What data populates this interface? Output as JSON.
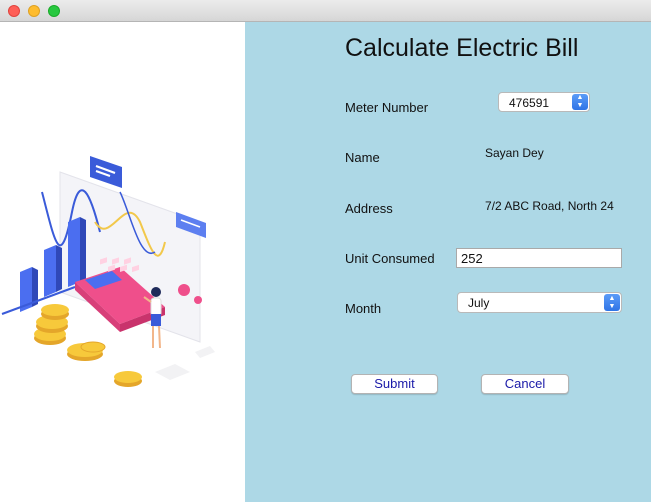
{
  "window": {
    "controls": [
      "close",
      "minimize",
      "maximize"
    ]
  },
  "form": {
    "title": "Calculate Electric Bill",
    "meter_number": {
      "label": "Meter Number",
      "value": "476591"
    },
    "name": {
      "label": "Name",
      "value": "Sayan Dey"
    },
    "address": {
      "label": "Address",
      "value": "7/2 ABC Road, North 24"
    },
    "unit_consumed": {
      "label": "Unit Consumed",
      "value": "252"
    },
    "month": {
      "label": "Month",
      "value": "July"
    },
    "buttons": {
      "submit": "Submit",
      "cancel": "Cancel"
    }
  },
  "colors": {
    "panel_background": "#add8e6",
    "left_background": "#ffffff",
    "button_text": "#1a1aa8",
    "select_accent": "#2f74e6"
  }
}
